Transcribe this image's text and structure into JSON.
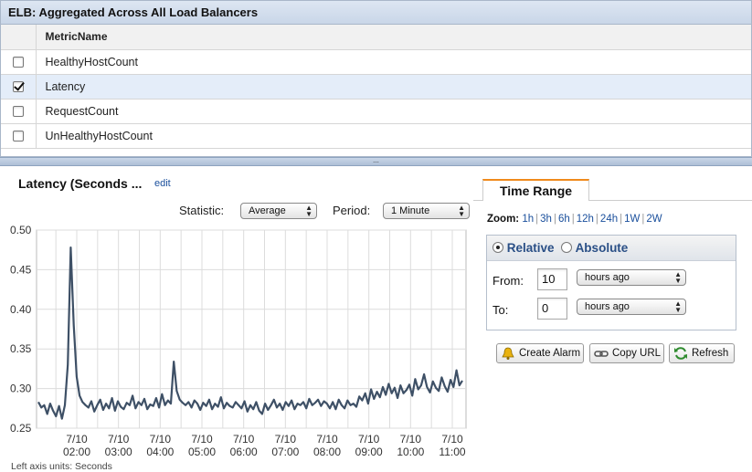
{
  "panel": {
    "title": "ELB: Aggregated Across All Load Balancers",
    "column_header": "MetricName",
    "metrics": [
      {
        "name": "HealthyHostCount",
        "checked": false
      },
      {
        "name": "Latency",
        "checked": true
      },
      {
        "name": "RequestCount",
        "checked": false
      },
      {
        "name": "UnHealthyHostCount",
        "checked": false
      }
    ]
  },
  "splitter": {
    "grip": "..."
  },
  "chart_panel": {
    "title": "Latency (Seconds ...",
    "edit_label": "edit",
    "statistic_label": "Statistic:",
    "statistic_value": "Average",
    "period_label": "Period:",
    "period_value": "1 Minute",
    "units_note": "Left axis units: Seconds"
  },
  "time_range": {
    "tab_label": "Time Range",
    "zoom_label": "Zoom:",
    "zoom_options": [
      "1h",
      "3h",
      "6h",
      "12h",
      "24h",
      "1W",
      "2W"
    ],
    "mode_relative": "Relative",
    "mode_absolute": "Absolute",
    "selected_mode": "Relative",
    "from_label": "From:",
    "from_value": "10",
    "from_unit": "hours ago",
    "to_label": "To:",
    "to_value": "0",
    "to_unit": "hours ago"
  },
  "buttons": {
    "create_alarm": "Create Alarm",
    "copy_url": "Copy URL",
    "refresh": "Refresh"
  },
  "colors": {
    "line": "#3e5066",
    "grid": "#dcdcdc",
    "link": "#1a4f9c",
    "accent_tab": "#f08a1c"
  },
  "chart_data": {
    "type": "line",
    "title": "Latency (Seconds ...",
    "xlabel": "",
    "ylabel": "",
    "ylim": [
      0.25,
      0.5
    ],
    "yticks": [
      "0.50",
      "0.45",
      "0.40",
      "0.35",
      "0.30",
      "0.25"
    ],
    "xticks": [
      [
        "7/10",
        "02:00"
      ],
      [
        "7/10",
        "03:00"
      ],
      [
        "7/10",
        "04:00"
      ],
      [
        "7/10",
        "05:00"
      ],
      [
        "7/10",
        "06:00"
      ],
      [
        "7/10",
        "07:00"
      ],
      [
        "7/10",
        "08:00"
      ],
      [
        "7/10",
        "09:00"
      ],
      [
        "7/10",
        "10:00"
      ],
      [
        "7/10",
        "11:00"
      ]
    ],
    "grid": true,
    "series": [
      {
        "values": [
          0.283,
          0.276,
          0.279,
          0.268,
          0.281,
          0.272,
          0.265,
          0.278,
          0.262,
          0.279,
          0.33,
          0.478,
          0.38,
          0.315,
          0.291,
          0.283,
          0.279,
          0.276,
          0.284,
          0.271,
          0.279,
          0.286,
          0.273,
          0.281,
          0.275,
          0.288,
          0.272,
          0.284,
          0.277,
          0.274,
          0.282,
          0.279,
          0.291,
          0.275,
          0.283,
          0.279,
          0.287,
          0.274,
          0.28,
          0.278,
          0.288,
          0.276,
          0.293,
          0.279,
          0.285,
          0.281,
          0.334,
          0.297,
          0.286,
          0.282,
          0.279,
          0.283,
          0.276,
          0.285,
          0.281,
          0.273,
          0.282,
          0.278,
          0.286,
          0.274,
          0.281,
          0.277,
          0.289,
          0.275,
          0.282,
          0.278,
          0.276,
          0.283,
          0.279,
          0.275,
          0.284,
          0.271,
          0.279,
          0.274,
          0.283,
          0.272,
          0.268,
          0.281,
          0.273,
          0.279,
          0.286,
          0.276,
          0.281,
          0.273,
          0.283,
          0.278,
          0.285,
          0.274,
          0.281,
          0.279,
          0.283,
          0.275,
          0.287,
          0.279,
          0.282,
          0.286,
          0.278,
          0.284,
          0.281,
          0.275,
          0.283,
          0.274,
          0.286,
          0.279,
          0.275,
          0.285,
          0.279,
          0.281,
          0.277,
          0.29,
          0.285,
          0.294,
          0.281,
          0.299,
          0.287,
          0.296,
          0.289,
          0.302,
          0.292,
          0.306,
          0.294,
          0.301,
          0.288,
          0.304,
          0.294,
          0.298,
          0.305,
          0.291,
          0.312,
          0.299,
          0.304,
          0.318,
          0.302,
          0.295,
          0.309,
          0.301,
          0.297,
          0.314,
          0.303,
          0.296,
          0.311,
          0.302,
          0.323,
          0.304,
          0.31
        ]
      }
    ]
  }
}
